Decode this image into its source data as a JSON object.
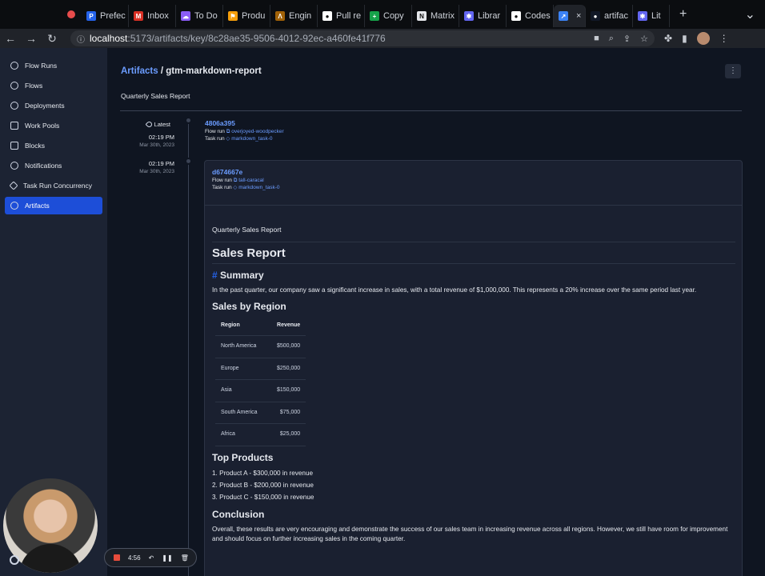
{
  "browser": {
    "tabs": [
      {
        "label": "Prefec",
        "color": "#2563eb",
        "glyph": "P"
      },
      {
        "label": "Inbox",
        "color": "#d93025",
        "glyph": "M"
      },
      {
        "label": "To Do",
        "color": "#8b5cf6",
        "glyph": "☁"
      },
      {
        "label": "Produ",
        "color": "#f59e0b",
        "glyph": "⚑"
      },
      {
        "label": "Engin",
        "color": "#a16207",
        "glyph": "Λ"
      },
      {
        "label": "Pull re",
        "color": "#ffffff",
        "glyph": "●"
      },
      {
        "label": "Copy",
        "color": "#16a34a",
        "glyph": "+"
      },
      {
        "label": "Matrix",
        "color": "#e5e7eb",
        "glyph": "N"
      },
      {
        "label": "Librar",
        "color": "#6366f1",
        "glyph": "✱"
      },
      {
        "label": "Codes",
        "color": "#ffffff",
        "glyph": "●"
      },
      {
        "label": "",
        "color": "#3b82f6",
        "glyph": "↗",
        "active": true
      },
      {
        "label": "artifac",
        "color": "#111827",
        "glyph": "●"
      },
      {
        "label": "Lit",
        "color": "#6366f1",
        "glyph": "✱"
      }
    ],
    "url_host": "localhost",
    "url_path": ":5173/artifacts/key/8c28ae35-9506-4012-92ec-a460fe41f776"
  },
  "sidebar": {
    "items": [
      {
        "label": "Flow Runs",
        "icon": "flow-runs-icon"
      },
      {
        "label": "Flows",
        "icon": "flows-icon"
      },
      {
        "label": "Deployments",
        "icon": "deployments-icon"
      },
      {
        "label": "Work Pools",
        "icon": "work-pools-icon"
      },
      {
        "label": "Blocks",
        "icon": "blocks-icon"
      },
      {
        "label": "Notifications",
        "icon": "bell-icon"
      },
      {
        "label": "Task Run Concurrency",
        "icon": "concurrency-icon"
      },
      {
        "label": "Artifacts",
        "icon": "fingerprint-icon",
        "active": true
      }
    ]
  },
  "page": {
    "breadcrumb_link": "Artifacts",
    "breadcrumb_sep": " / ",
    "breadcrumb_current": "gtm-markdown-report",
    "subtitle": "Quarterly Sales Report"
  },
  "timeline": {
    "entries": [
      {
        "badge": "Latest",
        "time": "02:19 PM",
        "date": "Mar 30th, 2023",
        "hash": "4806a395",
        "flow_run_label": "Flow run",
        "flow_run": "overjoyed-woodpecker",
        "task_run_label": "Task run",
        "task_run": "markdown_task-0"
      },
      {
        "time": "02:19 PM",
        "date": "Mar 30th, 2023",
        "hash": "d674667e",
        "flow_run_label": "Flow run",
        "flow_run": "tall-caracal",
        "task_run_label": "Task run",
        "task_run": "markdown_task-0"
      }
    ]
  },
  "report": {
    "description": "Quarterly Sales Report",
    "title": "Sales Report",
    "summary_pound": "#",
    "summary_heading": "Summary",
    "summary_text": "In the past quarter, our company saw a significant increase in sales, with a total revenue of $1,000,000. This represents a 20% increase over the same period last year.",
    "region_heading": "Sales by Region",
    "table_headers": [
      "Region",
      "Revenue"
    ],
    "table_rows": [
      [
        "North America",
        "$500,000"
      ],
      [
        "Europe",
        "$250,000"
      ],
      [
        "Asia",
        "$150,000"
      ],
      [
        "South America",
        "$75,000"
      ],
      [
        "Africa",
        "$25,000"
      ]
    ],
    "products_heading": "Top Products",
    "products": [
      "1. Product A - $300,000 in revenue",
      "2. Product B - $200,000 in revenue",
      "3. Product C - $150,000 in revenue"
    ],
    "conclusion_heading": "Conclusion",
    "conclusion_text": "Overall, these results are very encouraging and demonstrate the success of our sales team in increasing revenue across all regions. However, we still have room for improvement and should focus on further increasing sales in the coming quarter."
  },
  "recorder": {
    "elapsed": "4:56"
  }
}
